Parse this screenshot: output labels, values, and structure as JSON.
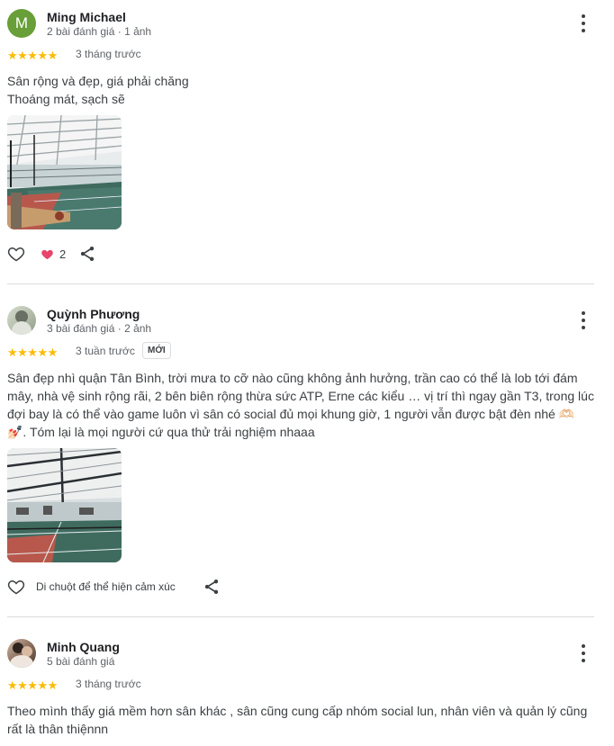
{
  "reviews": [
    {
      "author": "Ming Michael",
      "avatar_initial": "M",
      "meta": "2 bài đánh giá · 1 ảnh",
      "rating": 5,
      "stars": "★★★★★",
      "when": "3 tháng trước",
      "text_lines": [
        "Sân rộng và đẹp, giá phải chăng",
        "Thoáng mát, sạch sẽ"
      ],
      "reaction_count": "2",
      "icons": [
        "more-vert-icon",
        "heart-outline-icon",
        "heart-filled-icon",
        "share-icon"
      ]
    },
    {
      "author": "Quỳnh Phương",
      "meta": "3 bài đánh giá · 2 ảnh",
      "rating": 5,
      "stars": "★★★★★",
      "when": "3 tuần trước",
      "badge": "MỚI",
      "text_lines": [
        "Sân đẹp nhì quận Tân Bình, trời mưa to cỡ nào cũng không ảnh hưởng, trần cao có thể là lob tới đám",
        "mây, nhà vệ sinh rộng rãi, 2 bên biên rộng thừa sức ATP, Erne các kiểu … vị trí thì ngay gần T3, trong lúc",
        "đợi bay là có thể vào game luôn vì sân có social đủ mọi khung giờ, 1 người vẫn được bật đèn nhé 🫶🏻",
        "💅🏻. Tóm lại là mọi người cứ qua thử trải nghiệm nhaaa"
      ],
      "reaction_hint": "Di chuột để thể hiện cảm xúc"
    },
    {
      "author": "Minh Quang",
      "meta": "5 bài đánh giá",
      "rating": 5,
      "stars": "★★★★★",
      "when": "3 tháng trước",
      "text_lines": [
        "Theo mình thấy giá mềm hơn sân khác , sân cũng cung cấp nhóm social lun, nhân viên và quản lý cũng",
        "rất là thân thiệnnn"
      ]
    }
  ],
  "colors": {
    "star": "#fbbc04",
    "avatar_m": "#689f38",
    "heart": "#e8456b",
    "court_green": "#3f6b5f",
    "court_red": "#b8584d"
  }
}
